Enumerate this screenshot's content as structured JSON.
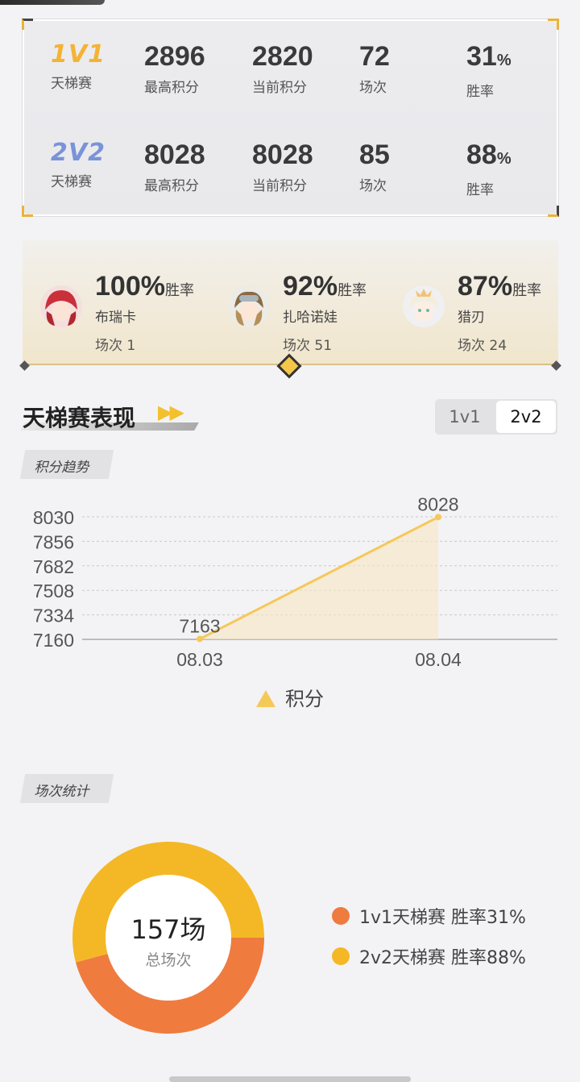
{
  "stats": {
    "rows": [
      {
        "mode": "1V1",
        "mode_sub": "天梯赛",
        "max_score": "2896",
        "max_score_label": "最高积分",
        "current_score": "2820",
        "current_score_label": "当前积分",
        "matches": "72",
        "matches_label": "场次",
        "win_rate": "31",
        "win_rate_unit": "%",
        "win_rate_label": "胜率",
        "color": "#f5b335"
      },
      {
        "mode": "2V2",
        "mode_sub": "天梯赛",
        "max_score": "8028",
        "max_score_label": "最高积分",
        "current_score": "8028",
        "current_score_label": "当前积分",
        "matches": "85",
        "matches_label": "场次",
        "win_rate": "88",
        "win_rate_unit": "%",
        "win_rate_label": "胜率",
        "color": "#7a93d8"
      }
    ]
  },
  "heroes": [
    {
      "rate": "100%",
      "rate_label": "胜率",
      "name": "布瑞卡",
      "count": "场次 1"
    },
    {
      "rate": "92%",
      "rate_label": "胜率",
      "name": "扎哈诺娃",
      "count": "场次 51"
    },
    {
      "rate": "87%",
      "rate_label": "胜率",
      "name": "猎刃",
      "count": "场次 24"
    }
  ],
  "section": {
    "title": "天梯赛表现",
    "tabs": [
      {
        "label": "1v1",
        "active": false
      },
      {
        "label": "2v2",
        "active": true
      }
    ]
  },
  "chips": {
    "trend": "积分趋势",
    "matches": "场次统计"
  },
  "chart_data": {
    "type": "line",
    "x": [
      "08.03",
      "08.04"
    ],
    "series": [
      {
        "name": "积分",
        "values": [
          7163,
          8028
        ],
        "color": "#f5c85a"
      }
    ],
    "yticks": [
      8030,
      7856,
      7682,
      7508,
      7334,
      7160
    ],
    "ylim": [
      7160,
      8030
    ],
    "grid": true,
    "legend": "bottom"
  },
  "donut": {
    "total": "157场",
    "total_label": "总场次",
    "segments": [
      {
        "label": "1v1天梯赛 胜率31%",
        "value": 72,
        "color": "#ef7b3f"
      },
      {
        "label": "2v2天梯赛 胜率88%",
        "value": 85,
        "color": "#f4b826"
      }
    ]
  }
}
